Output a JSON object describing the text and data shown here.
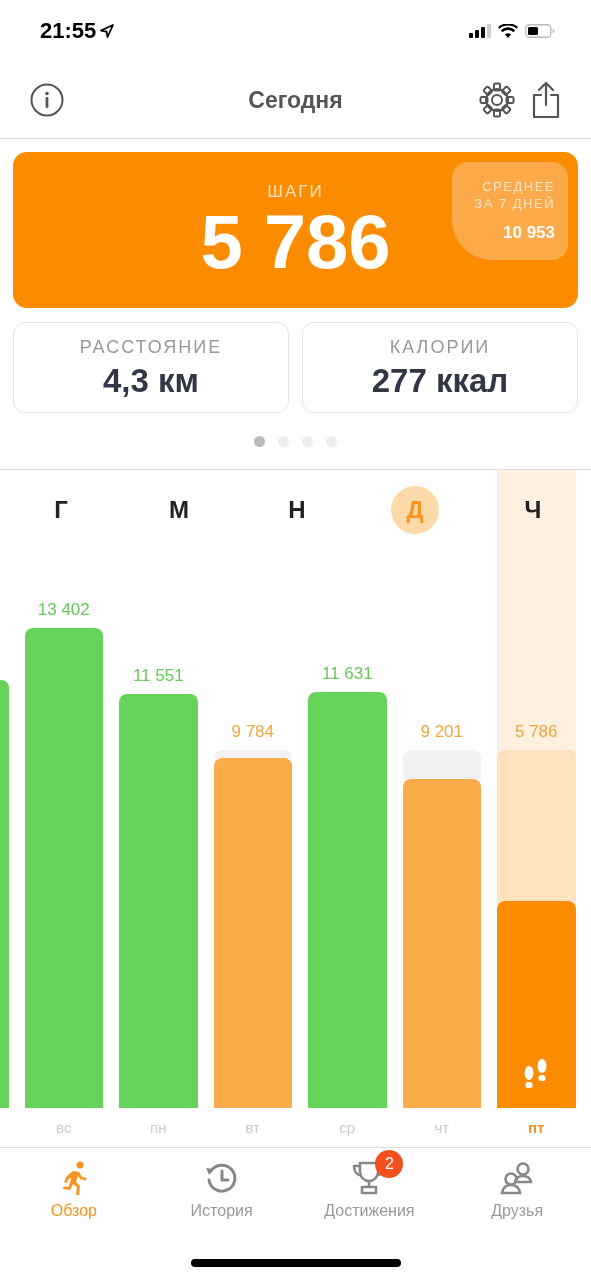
{
  "status_bar": {
    "time": "21:55"
  },
  "nav": {
    "title": "Сегодня"
  },
  "steps_card": {
    "label": "ШАГИ",
    "value": "5 786",
    "average": {
      "label": "СРЕДНЕЕ ЗА 7 ДНЕЙ",
      "value": "10 953"
    }
  },
  "stats": [
    {
      "label": "РАССТОЯНИЕ",
      "value": "4,3 км"
    },
    {
      "label": "КАЛОРИИ",
      "value": "277 ккал"
    }
  ],
  "pages": [
    {
      "selected": true
    },
    {
      "selected": false
    },
    {
      "selected": false
    },
    {
      "selected": false
    }
  ],
  "letters": [
    {
      "label": "Г",
      "selected": false
    },
    {
      "label": "М",
      "selected": false
    },
    {
      "label": "Н",
      "selected": false
    },
    {
      "label": "Д",
      "selected": true
    },
    {
      "label": "Ч",
      "selected": false
    }
  ],
  "days": [
    {
      "kind": "met"
    },
    {
      "kind": "met",
      "value": "13 402",
      "day": "вс"
    },
    {
      "kind": "met",
      "value": "11 551",
      "day": "пн"
    },
    {
      "kind": "unmet",
      "value": "9 784",
      "day": "вт"
    },
    {
      "kind": "met",
      "value": "11 631",
      "day": "ср"
    },
    {
      "kind": "unmet",
      "value": "9 201",
      "day": "чт"
    },
    {
      "kind": "today",
      "value": "5 786",
      "day": "пт"
    }
  ],
  "tabs": [
    {
      "kind": "runner",
      "label": "Обзор",
      "selected": true
    },
    {
      "kind": "history",
      "label": "История",
      "selected": false
    },
    {
      "kind": "trophy",
      "label": "Достижения",
      "selected": false,
      "badge": "2"
    },
    {
      "kind": "friends",
      "label": "Друзья",
      "selected": false
    }
  ]
}
